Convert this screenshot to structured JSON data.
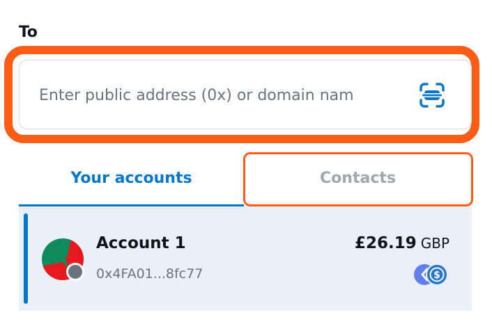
{
  "to_label": "To",
  "recipient_input": {
    "placeholder": "Enter public address (0x) or domain nam",
    "value": ""
  },
  "tabs": {
    "accounts": "Your accounts",
    "contacts": "Contacts",
    "active": "accounts"
  },
  "account": {
    "name": "Account 1",
    "address": "0x4FA01...8fc77",
    "balance_amount": "£26.19",
    "balance_currency": "GBP"
  },
  "icons": {
    "scan": "qr-scan-icon",
    "avatar": "account-avatar",
    "tokens": [
      "network-token-icon",
      "usdc-token-icon"
    ]
  },
  "colors": {
    "accent": "#0376c9",
    "highlight": "#ff5c16",
    "row_selected_bg": "#e9f0f9"
  }
}
